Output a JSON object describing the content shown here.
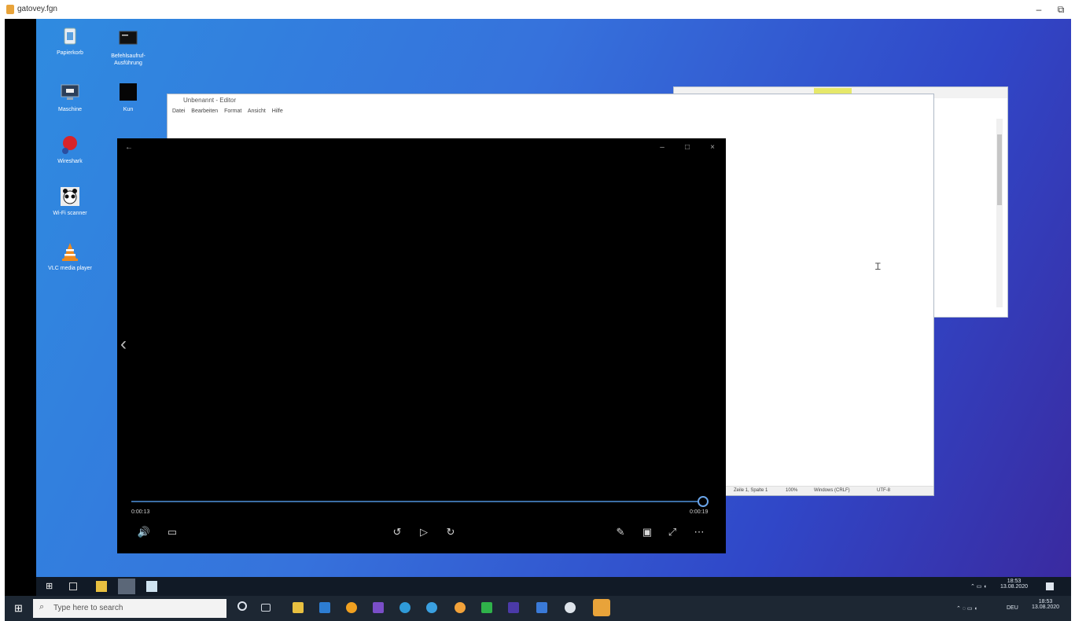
{
  "outer_window": {
    "title": "gatovey.fgn",
    "minimize": "–",
    "restore": "⧉"
  },
  "desktop": {
    "icons": [
      {
        "label": "Papierkorb",
        "icon": "recycle-bin-icon"
      },
      {
        "label": "Befehlsaufruf-Ausführung",
        "icon": "terminal-icon"
      },
      {
        "label": "Maschine",
        "icon": "monitor-icon"
      },
      {
        "label": "Kun",
        "icon": "console-icon"
      },
      {
        "label": "Wireshark",
        "icon": "red-app-icon"
      },
      {
        "label": "Wi-Fi scanner",
        "icon": "panda-icon"
      },
      {
        "label": "VLC media player",
        "icon": "vlc-cone-icon"
      }
    ]
  },
  "notepad": {
    "title": "Unbenannt - Editor",
    "menu": [
      "Datei",
      "Bearbeiten",
      "Format",
      "Ansicht",
      "Hilfe"
    ],
    "status": {
      "position": "Zeile 1, Spalte 1",
      "zoom": "100%",
      "eol": "Windows (CRLF)",
      "encoding": "UTF-8"
    }
  },
  "media_player": {
    "back": "←",
    "minimize": "–",
    "maximize": "□",
    "close": "×",
    "time_current": "0:00:13",
    "time_total": "0:00:19",
    "progress": 0.99,
    "buttons": {
      "volume": "🔊",
      "captions": "▭",
      "skip_back": "↺",
      "play": "▷",
      "skip_forward": "↻",
      "edit": "✎",
      "mini_view": "▣",
      "fullscreen": "⤢",
      "more": "⋯"
    },
    "prev_arrow": "‹"
  },
  "taskbar": {
    "search_placeholder": "Type here to search",
    "clock_time": "18:53",
    "clock_date": "13.08.2020",
    "lang": "DEU",
    "inner_time": "18:53",
    "inner_date": "13.08.2020"
  },
  "colors": {
    "desktop_start": "#2f8be0",
    "desktop_end": "#3a2aa0",
    "taskbar": "#1d2733",
    "seek_accent": "#3b6ea5"
  }
}
